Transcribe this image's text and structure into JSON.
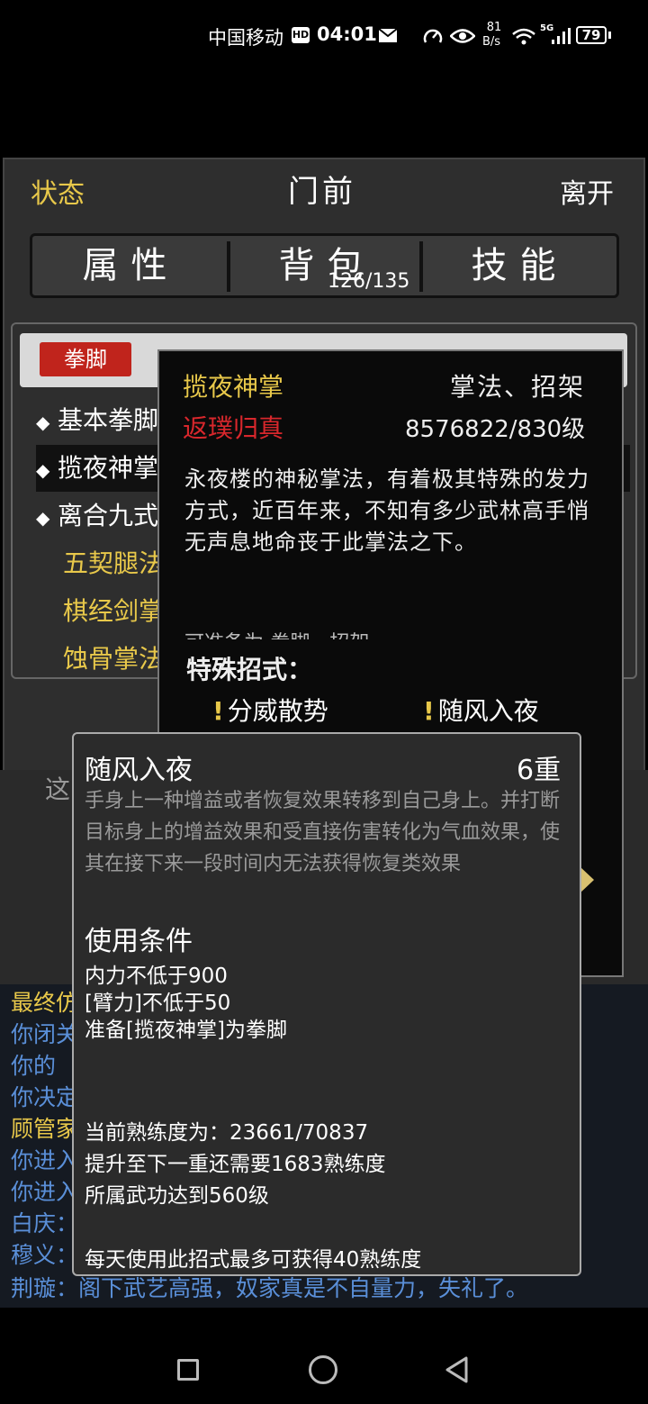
{
  "status_bar": {
    "carrier": "中国移动",
    "hd": "HD",
    "time": "04:01",
    "net_speed_value": "81",
    "net_speed_unit": "B/s",
    "signal": "5G",
    "battery": "79"
  },
  "header": {
    "left": "状态",
    "title": "门前",
    "right": "离开"
  },
  "tabs": {
    "attributes": "属性",
    "bag": "背包",
    "bag_count": "126/135",
    "skills": "技能"
  },
  "skills_panel": {
    "category": "拳脚",
    "rows": [
      {
        "text": "基本拳脚"
      },
      {
        "text": "揽夜神掌"
      },
      {
        "text": "离合九式"
      },
      {
        "text": "五契腿法"
      },
      {
        "text": "棋经剑掌"
      },
      {
        "text": "蚀骨掌法"
      }
    ]
  },
  "skill_detail": {
    "name": "揽夜神掌",
    "type": "掌法、招架",
    "rank": "返璞归真",
    "level": "8576822/830级",
    "description": "永夜楼的神秘掌法，有着极其特殊的发力方式，近百年来，不知有多少武林高手悄无声息地命丧于此掌法之下。",
    "cut_text": "可准备为:拳脚、招架",
    "special_title": "特殊招式：",
    "moves": [
      "分威散势",
      "随风入夜"
    ]
  },
  "move_tip": {
    "name": "随风入夜",
    "level": "6重",
    "description": "手身上一种增益或者恢复效果转移到自己身上。并打断目标身上的增益效果和受直接伤害转化为气血效果，使其在接下来一段时间内无法获得恢复类效果",
    "conditions_title": "使用条件",
    "conditions": [
      "内力不低于900",
      "[臂力]不低于50",
      "准备[揽夜神掌]为拳脚"
    ],
    "proficiency": "当前熟练度为：23661/70837",
    "next_level": "提升至下一重还需要1683熟练度",
    "req_level": "所属武功达到560级",
    "daily": "每天使用此招式最多可获得40熟练度"
  },
  "log": {
    "partial_behind": "这",
    "lines": [
      {
        "text": "最终仿",
        "color": "#e8c84a"
      },
      {
        "text": "你闭关",
        "color": "#5a8fd8"
      },
      {
        "text": "你的",
        "color": "#5a8fd8"
      },
      {
        "text": "你决定",
        "color": "#5a8fd8"
      },
      {
        "text": "顾管家",
        "color": "#e8c84a"
      },
      {
        "text": "你进入",
        "color": "#5a8fd8"
      },
      {
        "text": "你进入",
        "color": "#5a8fd8"
      },
      {
        "text": "白庆：",
        "color": "#5a8fd8"
      },
      {
        "text": "穆义：",
        "color": "#5a8fd8"
      },
      {
        "text": "荆璇：阁下武艺高强，奴家真是不自量力，失礼了。",
        "color": "#5a8fd8"
      }
    ]
  }
}
